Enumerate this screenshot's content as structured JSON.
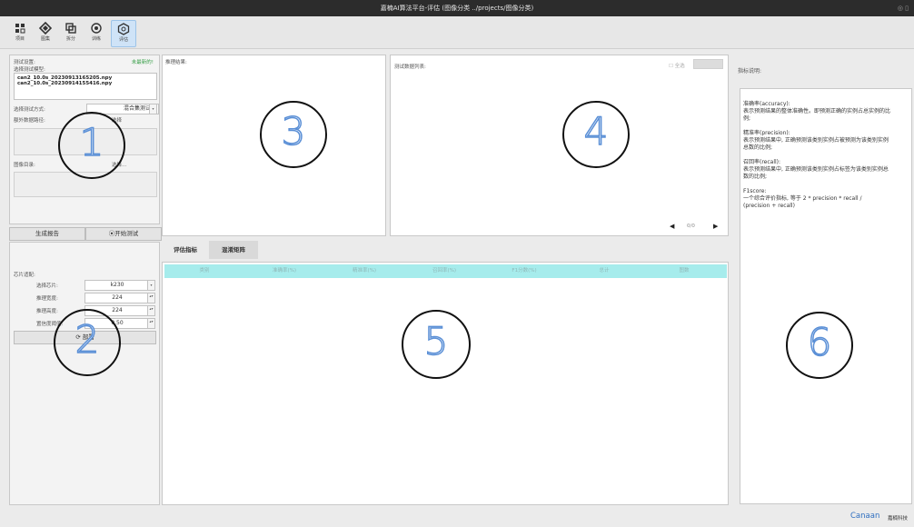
{
  "window": {
    "title": "嘉楠AI算法平台-评估 (图像分类 ../projects/图像分类)",
    "controls": "◎ ▯"
  },
  "toolbar": [
    {
      "label": "项目",
      "icon": "project-icon"
    },
    {
      "label": "图集",
      "icon": "image-set-icon"
    },
    {
      "label": "拆分",
      "icon": "split-icon"
    },
    {
      "label": "训练",
      "icon": "train-icon"
    },
    {
      "label": "评估",
      "icon": "evaluate-icon",
      "active": true
    }
  ],
  "test_settings": {
    "title": "测试设置:",
    "status": "未最新的!",
    "model_label": "选择测试模型:",
    "models": [
      "can2_10.0s_20230913165205.npy",
      "can2_10.0s_20230914155416.npy"
    ],
    "method_label": "选择测试方式:",
    "method_value": "混合集测试",
    "extra_data_label": "额外数据路径:",
    "extra_data_browse": "选择",
    "image_dir_label": "图像目录:",
    "image_dir_browse": "选择..."
  },
  "actions": {
    "report": "生成报告",
    "start": "⦿开始测试"
  },
  "chip": {
    "title": "芯片适配:",
    "chip_label": "选择芯片:",
    "chip_value": "k230",
    "width_label": "推理宽度:",
    "width_value": "224",
    "height_label": "推理高度:",
    "height_value": "224",
    "conf_label": "置信度阈值:",
    "conf_value": "0.50",
    "apply": "⟳ 部署"
  },
  "infer_result": {
    "title": "推理结果:"
  },
  "test_list": {
    "title": "测试数据列表:",
    "all_label": "☐ 全选",
    "prev": "◀",
    "page": "0/0",
    "next": "▶"
  },
  "tabs": [
    "评估指标",
    "混淆矩阵"
  ],
  "metrics_table": {
    "headers": [
      "类别",
      "准确率(%)",
      "精准率(%)",
      "召回率(%)",
      "F1分数(%)",
      "总计",
      "图数"
    ]
  },
  "metric_explain": {
    "title": "指标说明:",
    "lines": [
      "准确率(accuracy):",
      "表示预测结果的整体准确性。即预测正确的实例占总实例的比",
      "例;",
      "",
      "精准率(precision):",
      "表示预测结果中, 正确预测该类别实例占被预测为该类别实例",
      "总数的比例;",
      "",
      "召回率(recall):",
      "表示预测结果中, 正确预测该类别实例占标签为该类别实例总",
      "数的比例;",
      "",
      "F1score:",
      "一个综合评价指标, 等于 2 * precision * recall /",
      "(precision + recall)"
    ]
  },
  "annotations": [
    "1",
    "2",
    "3",
    "4",
    "5",
    "6"
  ],
  "footer": {
    "brand": "Canaan",
    "company": "嘉楠科技"
  }
}
